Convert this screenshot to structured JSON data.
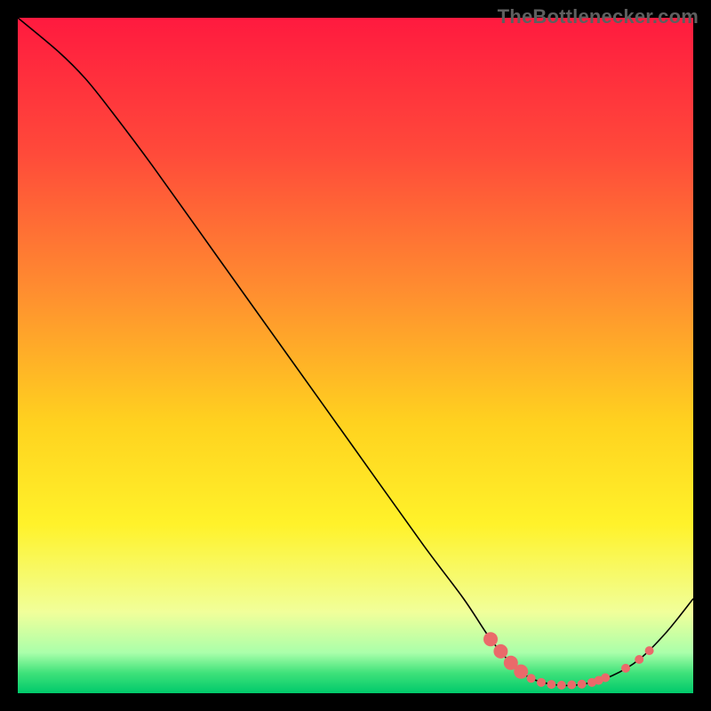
{
  "watermark": "TheBottlenecker.com",
  "chart_data": {
    "type": "line",
    "title": "",
    "xlabel": "",
    "ylabel": "",
    "xlim": [
      0,
      100
    ],
    "ylim": [
      0,
      100
    ],
    "legend": false,
    "grid": false,
    "background_gradient": {
      "direction": "top-to-bottom",
      "stops": [
        {
          "offset": 0.0,
          "color": "#ff1a3f"
        },
        {
          "offset": 0.2,
          "color": "#ff4a3a"
        },
        {
          "offset": 0.4,
          "color": "#ff8c30"
        },
        {
          "offset": 0.6,
          "color": "#ffd21f"
        },
        {
          "offset": 0.75,
          "color": "#fff22a"
        },
        {
          "offset": 0.88,
          "color": "#f1ff9a"
        },
        {
          "offset": 0.94,
          "color": "#aaffaa"
        },
        {
          "offset": 0.97,
          "color": "#3fe27a"
        },
        {
          "offset": 1.0,
          "color": "#00c96b"
        }
      ]
    },
    "series": [
      {
        "name": "bottleneck-curve",
        "color": "#000000",
        "width": 1.6,
        "points": [
          {
            "x": 0,
            "y": 100
          },
          {
            "x": 6,
            "y": 95
          },
          {
            "x": 10,
            "y": 91
          },
          {
            "x": 14,
            "y": 86
          },
          {
            "x": 20,
            "y": 78
          },
          {
            "x": 30,
            "y": 64
          },
          {
            "x": 40,
            "y": 50
          },
          {
            "x": 50,
            "y": 36
          },
          {
            "x": 60,
            "y": 22
          },
          {
            "x": 66,
            "y": 14
          },
          {
            "x": 70,
            "y": 8
          },
          {
            "x": 73,
            "y": 4.5
          },
          {
            "x": 76,
            "y": 2.2
          },
          {
            "x": 80,
            "y": 1.2
          },
          {
            "x": 84,
            "y": 1.4
          },
          {
            "x": 88,
            "y": 2.6
          },
          {
            "x": 92,
            "y": 5
          },
          {
            "x": 96,
            "y": 9
          },
          {
            "x": 100,
            "y": 14
          }
        ]
      }
    ],
    "scatter": {
      "name": "data-points",
      "color": "#ea6a6a",
      "radius_small": 5,
      "radius_large": 8,
      "points": [
        {
          "x": 70.0,
          "y": 8.0,
          "r": "large"
        },
        {
          "x": 71.5,
          "y": 6.2,
          "r": "large"
        },
        {
          "x": 73.0,
          "y": 4.5,
          "r": "large"
        },
        {
          "x": 74.5,
          "y": 3.2,
          "r": "large"
        },
        {
          "x": 76.0,
          "y": 2.2,
          "r": "small"
        },
        {
          "x": 77.5,
          "y": 1.6,
          "r": "small"
        },
        {
          "x": 79.0,
          "y": 1.3,
          "r": "small"
        },
        {
          "x": 80.5,
          "y": 1.2,
          "r": "small"
        },
        {
          "x": 82.0,
          "y": 1.25,
          "r": "small"
        },
        {
          "x": 83.5,
          "y": 1.35,
          "r": "small"
        },
        {
          "x": 85.0,
          "y": 1.6,
          "r": "small"
        },
        {
          "x": 86.0,
          "y": 1.9,
          "r": "small"
        },
        {
          "x": 87.0,
          "y": 2.3,
          "r": "small"
        },
        {
          "x": 90.0,
          "y": 3.7,
          "r": "small"
        },
        {
          "x": 92.0,
          "y": 5.0,
          "r": "small"
        },
        {
          "x": 93.5,
          "y": 6.3,
          "r": "small"
        }
      ]
    }
  }
}
